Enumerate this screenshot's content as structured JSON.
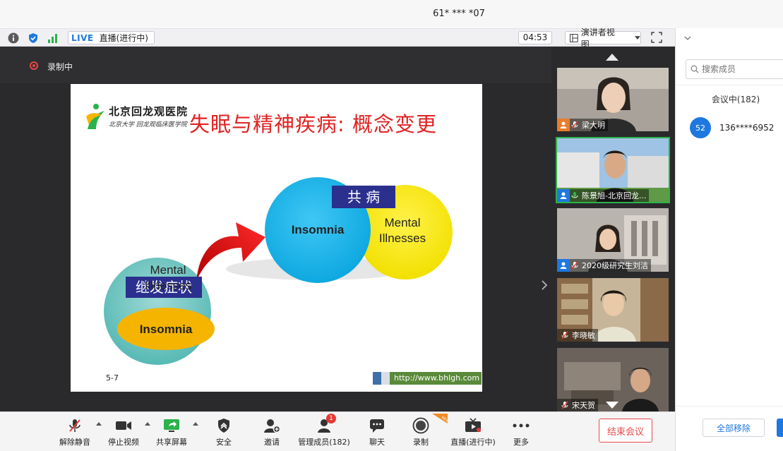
{
  "window": {
    "title": "61* *** *07"
  },
  "statusbar": {
    "live_badge": "LIVE",
    "live_status": "直播(进行中)",
    "timer": "04:53",
    "view_mode": "演讲者视图"
  },
  "stage": {
    "recording_label": "录制中"
  },
  "slide": {
    "logo_name": "北京回龙观医院",
    "logo_sub": "北京大学 回龙观临床医学院",
    "title": "失眠与精神疾病: 概念变更",
    "left_label": "继发症状",
    "left_outer": "Mental\nIllnesses",
    "left_inner": "Insomnia",
    "right_label": "共 病",
    "right_a": "Insomnia",
    "right_b": "Mental\nIllnesses",
    "page_num": "5-7",
    "url": "http://www.bhlgh.com"
  },
  "participants": [
    {
      "name": "梁大明",
      "role": "host",
      "muted": true
    },
    {
      "name": "陈景旭-北京回龙...",
      "role": "user",
      "muted": false,
      "active": true
    },
    {
      "name": "2020级研究生刘洁",
      "role": "user",
      "muted": true
    },
    {
      "name": "李晓敏",
      "role": "none",
      "muted": true
    },
    {
      "name": "宋天贺",
      "role": "none",
      "muted": true
    }
  ],
  "panel": {
    "search_placeholder": "搜索成员",
    "in_meeting": "会议中(182)",
    "member_badge": "52",
    "member_name": "136****6952",
    "remove_all": "全部移除"
  },
  "toolbar": {
    "unmute": "解除静音",
    "stop_video": "停止视频",
    "share": "共享屏幕",
    "security": "安全",
    "invite": "邀请",
    "manage": "管理成员(182)",
    "manage_badge": "1",
    "chat": "聊天",
    "record": "录制",
    "new_tag": "NEW",
    "live": "直播(进行中)",
    "more": "更多",
    "end": "结束会议"
  },
  "colors": {
    "accent_blue": "#1e78e0",
    "end_red": "#e84a4a",
    "slide_title_red": "#e02222",
    "label_navy": "#2b2f8e",
    "active_green": "#2bb24c"
  }
}
